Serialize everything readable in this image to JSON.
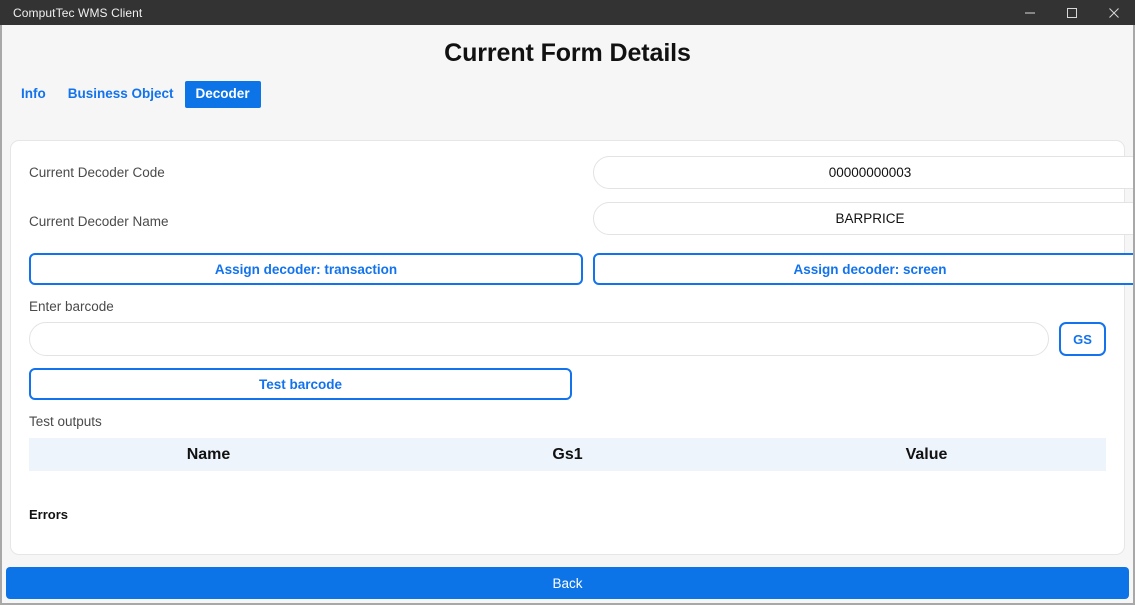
{
  "window": {
    "title": "ComputTec WMS Client",
    "controls": [
      {
        "name": "minimize",
        "label": "–"
      },
      {
        "name": "maximize",
        "label": "□"
      },
      {
        "name": "close",
        "label": "✕"
      }
    ]
  },
  "header": {
    "title": "Current Form Details"
  },
  "tabs": [
    {
      "label": "Info",
      "active": false
    },
    {
      "label": "Business Object",
      "active": false
    },
    {
      "label": "Decoder",
      "active": true
    }
  ],
  "form": {
    "decoder_code_label": "Current Decoder Code",
    "decoder_code_value": "00000000003",
    "decoder_name_label": "Current Decoder Name",
    "decoder_name_value": "BARPRICE",
    "assign_transaction_label": "Assign decoder: transaction",
    "assign_screen_label": "Assign decoder: screen",
    "enter_barcode_label": "Enter barcode",
    "barcode_value": "",
    "barcode_placeholder": "",
    "gs_label": "GS",
    "test_barcode_label": "Test barcode"
  },
  "test_outputs": {
    "section_label": "Test outputs",
    "columns": [
      "Name",
      "Gs1",
      "Value"
    ],
    "rows": [],
    "errors_label": "Errors",
    "errors": []
  },
  "footer": {
    "back_label": "Back"
  },
  "colors": {
    "accent": "#0d74e7",
    "accent_text": "#1273ec",
    "titlebar": "#333333",
    "page_bg": "#f6f6f6",
    "table_head_bg": "#eef4fc"
  }
}
